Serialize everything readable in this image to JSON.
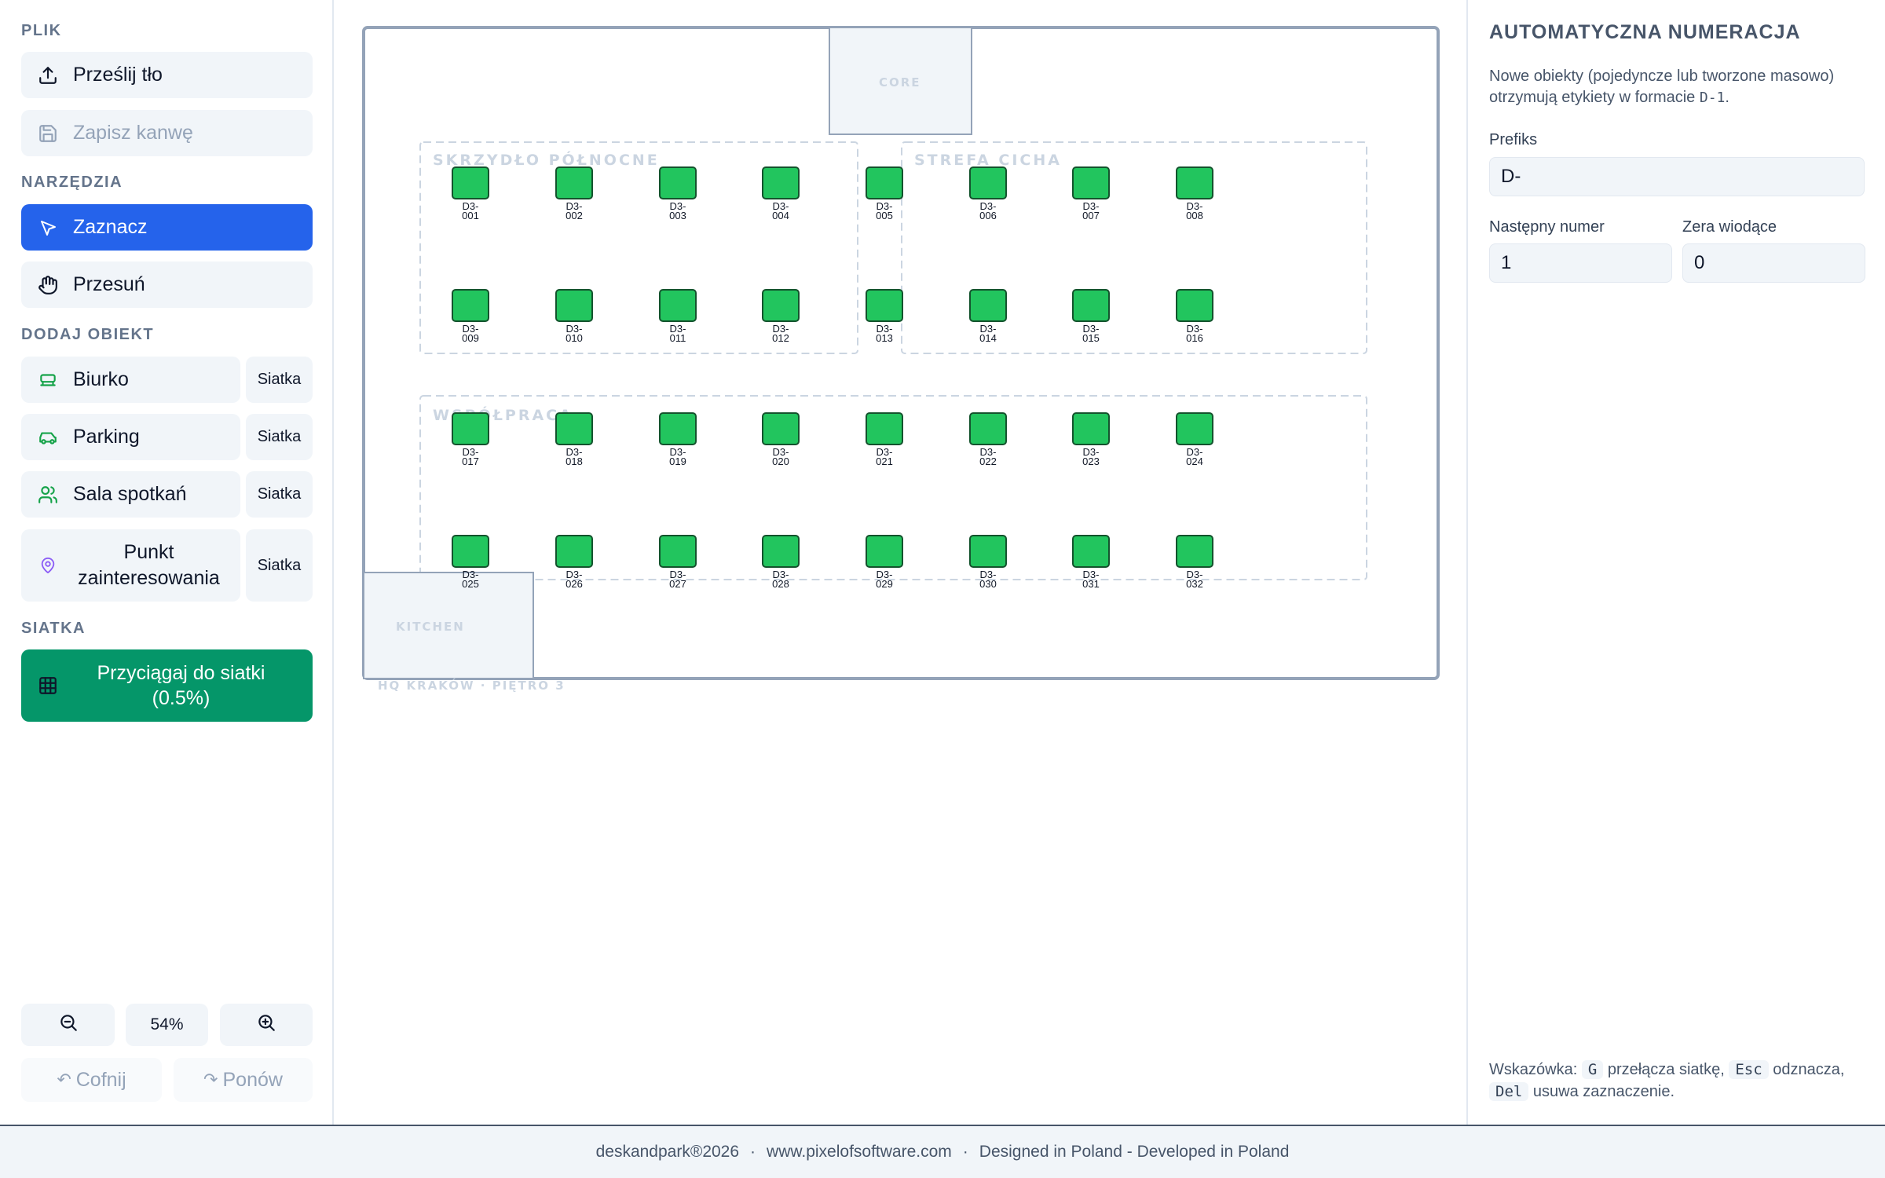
{
  "sidebar": {
    "file_title": "PLIK",
    "upload_label": "Prześlij tło",
    "save_label": "Zapisz kanwę",
    "tools_title": "NARZĘDZIA",
    "select_label": "Zaznacz",
    "move_label": "Przesuń",
    "add_title": "DODAJ OBIEKT",
    "objects": [
      {
        "label": "Biurko",
        "grid_label": "Siatka",
        "icon": "desk-icon"
      },
      {
        "label": "Parking",
        "grid_label": "Siatka",
        "icon": "car-icon"
      },
      {
        "label": "Sala spotkań",
        "grid_label": "Siatka",
        "icon": "users-icon"
      },
      {
        "label": "Punkt zainteresowania",
        "grid_label": "Siatka",
        "icon": "map-pin-icon"
      }
    ],
    "grid_title": "SIATKA",
    "snap_label": "Przyciągaj do siatki (0.5%)",
    "zoom_level": "54%",
    "undo_label": "Cofnij",
    "redo_label": "Ponów"
  },
  "canvas": {
    "floor_label": "HQ KRAKÓW · PIĘTRO 3",
    "rooms": [
      {
        "label": "CORE"
      },
      {
        "label": "KITCHEN"
      }
    ],
    "zones": [
      {
        "label": "SKRZYDŁO PÓŁNOCNE"
      },
      {
        "label": "STREFA CICHA"
      },
      {
        "label": "WSPÓŁPRACA"
      }
    ],
    "desks": [
      {
        "l1": "D3-",
        "l2": "001"
      },
      {
        "l1": "D3-",
        "l2": "002"
      },
      {
        "l1": "D3-",
        "l2": "003"
      },
      {
        "l1": "D3-",
        "l2": "004"
      },
      {
        "l1": "D3-",
        "l2": "005"
      },
      {
        "l1": "D3-",
        "l2": "006"
      },
      {
        "l1": "D3-",
        "l2": "007"
      },
      {
        "l1": "D3-",
        "l2": "008"
      },
      {
        "l1": "D3-",
        "l2": "009"
      },
      {
        "l1": "D3-",
        "l2": "010"
      },
      {
        "l1": "D3-",
        "l2": "011"
      },
      {
        "l1": "D3-",
        "l2": "012"
      },
      {
        "l1": "D3-",
        "l2": "013"
      },
      {
        "l1": "D3-",
        "l2": "014"
      },
      {
        "l1": "D3-",
        "l2": "015"
      },
      {
        "l1": "D3-",
        "l2": "016"
      },
      {
        "l1": "D3-",
        "l2": "017"
      },
      {
        "l1": "D3-",
        "l2": "018"
      },
      {
        "l1": "D3-",
        "l2": "019"
      },
      {
        "l1": "D3-",
        "l2": "020"
      },
      {
        "l1": "D3-",
        "l2": "021"
      },
      {
        "l1": "D3-",
        "l2": "022"
      },
      {
        "l1": "D3-",
        "l2": "023"
      },
      {
        "l1": "D3-",
        "l2": "024"
      },
      {
        "l1": "D3-",
        "l2": "025"
      },
      {
        "l1": "D3-",
        "l2": "026"
      },
      {
        "l1": "D3-",
        "l2": "027"
      },
      {
        "l1": "D3-",
        "l2": "028"
      },
      {
        "l1": "D3-",
        "l2": "029"
      },
      {
        "l1": "D3-",
        "l2": "030"
      },
      {
        "l1": "D3-",
        "l2": "031"
      },
      {
        "l1": "D3-",
        "l2": "032"
      }
    ],
    "desk_color": "#22c55e"
  },
  "panel": {
    "title": "AUTOMATYCZNA NUMERACJA",
    "desc_before": "Nowe obiekty (pojedyncze lub tworzone masowo) otrzymują etykiety w formacie",
    "desc_code": "D-1",
    "desc_after": ".",
    "prefix_label": "Prefiks",
    "prefix_value": "D-",
    "next_label": "Następny numer",
    "next_value": "1",
    "zeros_label": "Zera wiodące",
    "zeros_value": "0",
    "hint_prefix": "Wskazówka:",
    "hint_key1": "G",
    "hint_text1": "przełącza siatkę,",
    "hint_key2": "Esc",
    "hint_text2": "odznacza,",
    "hint_key3": "Del",
    "hint_text3": "usuwa zaznaczenie."
  },
  "footer": {
    "brand": "deskandpark®2026",
    "site": "www.pixelofsoftware.com",
    "tagline": "Designed in Poland - Developed in Poland"
  },
  "colors": {
    "primary": "#2563eb",
    "snap_active": "#059669",
    "desk": "#22c55e"
  }
}
